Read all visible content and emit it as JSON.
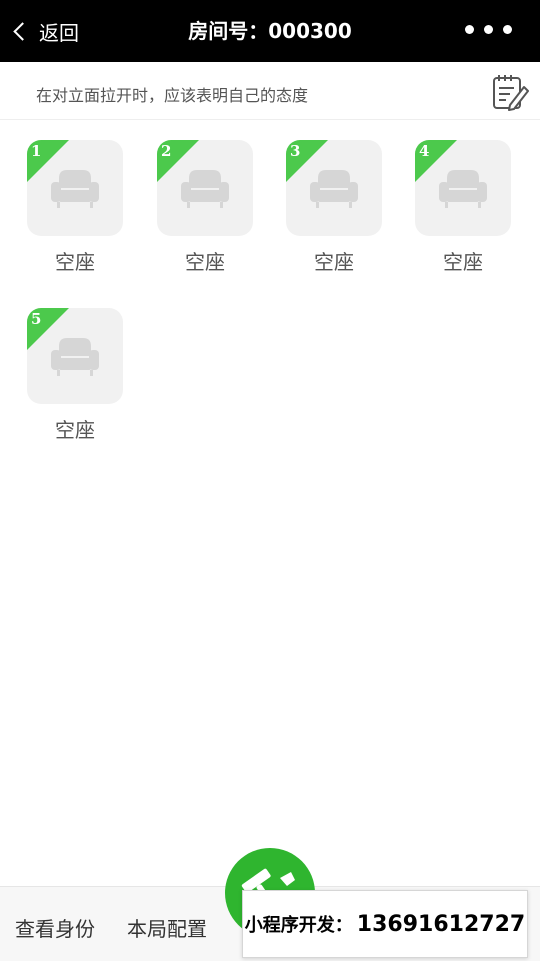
{
  "header": {
    "back_label": "返回",
    "title": "房间号：000300",
    "more_icon": "more-dots-icon"
  },
  "notice": {
    "text": "在对立面拉开时，应该表明自己的态度",
    "edit_icon": "notepad-edit-icon"
  },
  "seats": [
    {
      "number": "1",
      "label": "空座"
    },
    {
      "number": "2",
      "label": "空座"
    },
    {
      "number": "3",
      "label": "空座"
    },
    {
      "number": "4",
      "label": "空座"
    },
    {
      "number": "5",
      "label": "空座"
    }
  ],
  "bottom_bar": {
    "view_identity": "查看身份",
    "game_config": "本局配置"
  },
  "promo": {
    "label": "小程序开发：",
    "phone": "13691612727"
  },
  "colors": {
    "header_bg": "#000000",
    "accent_green": "#2fb52f",
    "corner_green": "#4cc94c",
    "seat_bg": "#f1f1f1"
  }
}
